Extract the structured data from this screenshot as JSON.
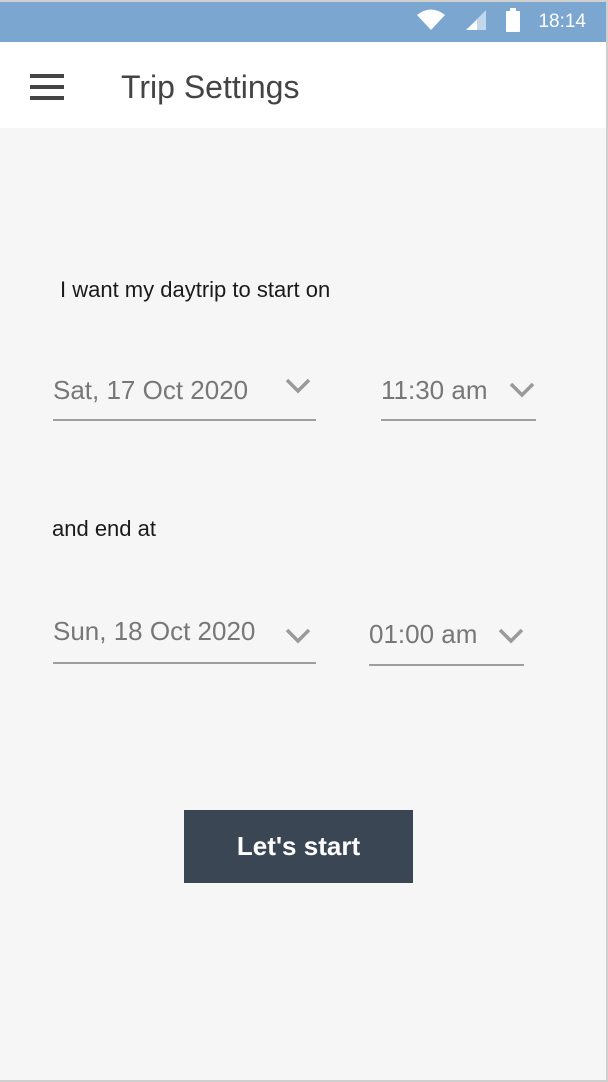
{
  "status_bar": {
    "time": "18:14",
    "icons": [
      "wifi-icon",
      "signal-icon",
      "battery-icon"
    ]
  },
  "app_bar": {
    "title": "Trip Settings",
    "menu_icon": "hamburger-menu-icon"
  },
  "start": {
    "prompt": "I want my daytrip to start on",
    "date": "Sat, 17 Oct 2020",
    "time": "11:30 am"
  },
  "end": {
    "prompt": "and end at",
    "date": "Sun, 18 Oct 2020",
    "time": "01:00 am"
  },
  "cta": {
    "label": "Let's start"
  },
  "colors": {
    "status_bar": "#7aa6d0",
    "app_bar": "#ffffff",
    "background": "#f6f6f6",
    "button": "#3a4654",
    "picker_text": "#777777",
    "underline": "#9e9e9e"
  }
}
